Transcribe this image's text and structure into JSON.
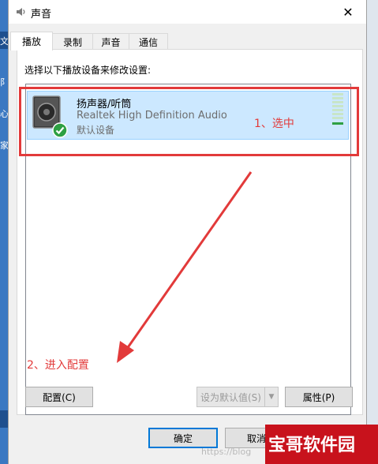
{
  "window": {
    "title": "声音",
    "close_glyph": "✕"
  },
  "tabs": [
    {
      "label": "播放",
      "active": true
    },
    {
      "label": "录制",
      "active": false
    },
    {
      "label": "声音",
      "active": false
    },
    {
      "label": "通信",
      "active": false
    }
  ],
  "playback": {
    "instruction": "选择以下播放设备来修改设置:",
    "device": {
      "name": "扬声器/听筒",
      "driver": "Realtek High Definition Audio",
      "status": "默认设备"
    }
  },
  "annotations": {
    "step1": "1、选中",
    "step2": "2、进入配置",
    "color": "#e23a3a"
  },
  "buttons": {
    "configure": "配置(C)",
    "set_default": "设为默认值(S)",
    "properties": "属性(P)",
    "ok": "确定",
    "cancel": "取消"
  },
  "background_side_chars": [
    "文",
    "阝",
    "心",
    "家"
  ],
  "watermark": {
    "brand": "宝哥软件园",
    "url": "https://blog"
  },
  "colors": {
    "selection": "#cce8ff",
    "accent": "#0078d7",
    "check": "#2ea043"
  }
}
